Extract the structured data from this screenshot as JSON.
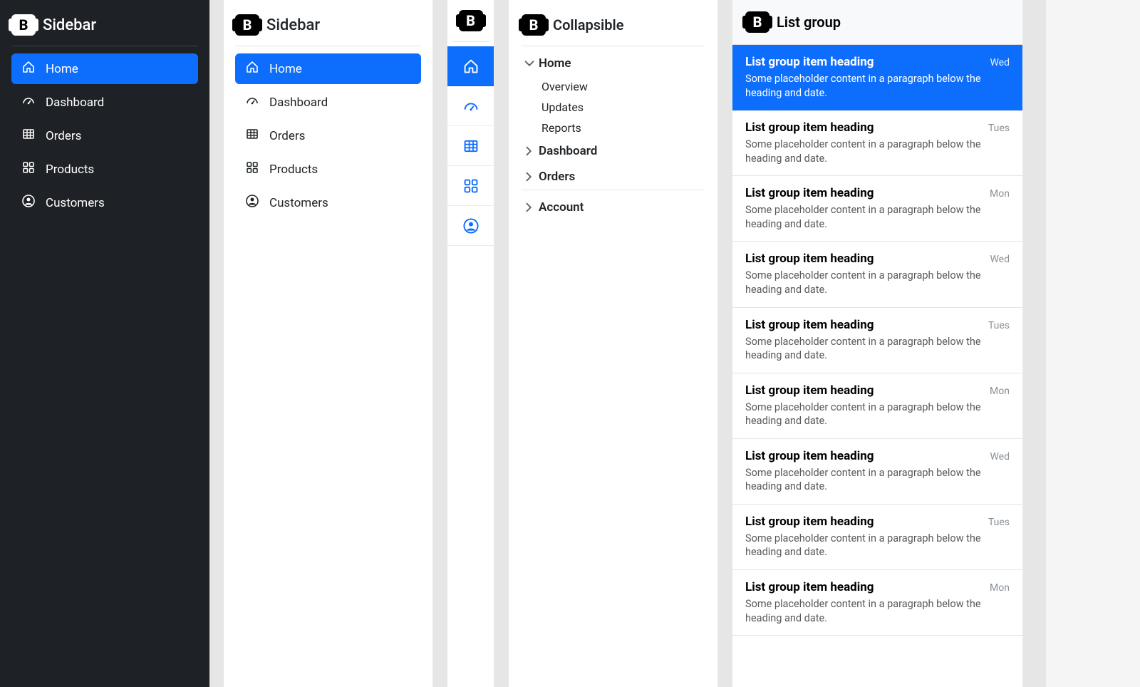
{
  "dark": {
    "title": "Sidebar",
    "items": [
      {
        "label": "Home",
        "active": true,
        "icon": "home"
      },
      {
        "label": "Dashboard",
        "active": false,
        "icon": "speedometer"
      },
      {
        "label": "Orders",
        "active": false,
        "icon": "table"
      },
      {
        "label": "Products",
        "active": false,
        "icon": "grid"
      },
      {
        "label": "Customers",
        "active": false,
        "icon": "person"
      }
    ]
  },
  "light": {
    "title": "Sidebar",
    "items": [
      {
        "label": "Home",
        "active": true,
        "icon": "home"
      },
      {
        "label": "Dashboard",
        "active": false,
        "icon": "speedometer"
      },
      {
        "label": "Orders",
        "active": false,
        "icon": "table"
      },
      {
        "label": "Products",
        "active": false,
        "icon": "grid"
      },
      {
        "label": "Customers",
        "active": false,
        "icon": "person"
      }
    ]
  },
  "icons": {
    "items": [
      {
        "icon": "home",
        "active": true
      },
      {
        "icon": "speedometer",
        "active": false
      },
      {
        "icon": "table",
        "active": false
      },
      {
        "icon": "grid",
        "active": false
      },
      {
        "icon": "person",
        "active": false
      }
    ]
  },
  "coll": {
    "title": "Collapsible",
    "sections": [
      {
        "label": "Home",
        "open": true,
        "items": [
          "Overview",
          "Updates",
          "Reports"
        ]
      },
      {
        "label": "Dashboard",
        "open": false,
        "items": []
      },
      {
        "label": "Orders",
        "open": false,
        "items": []
      }
    ],
    "extra": [
      {
        "label": "Account",
        "open": false
      }
    ]
  },
  "list": {
    "title": "List group",
    "item_heading": "List group item heading",
    "item_body": "Some placeholder content in a paragraph below the heading and date.",
    "items": [
      {
        "date": "Wed",
        "active": true
      },
      {
        "date": "Tues",
        "active": false
      },
      {
        "date": "Mon",
        "active": false
      },
      {
        "date": "Wed",
        "active": false
      },
      {
        "date": "Tues",
        "active": false
      },
      {
        "date": "Mon",
        "active": false
      },
      {
        "date": "Wed",
        "active": false
      },
      {
        "date": "Tues",
        "active": false
      },
      {
        "date": "Mon",
        "active": false
      }
    ]
  }
}
